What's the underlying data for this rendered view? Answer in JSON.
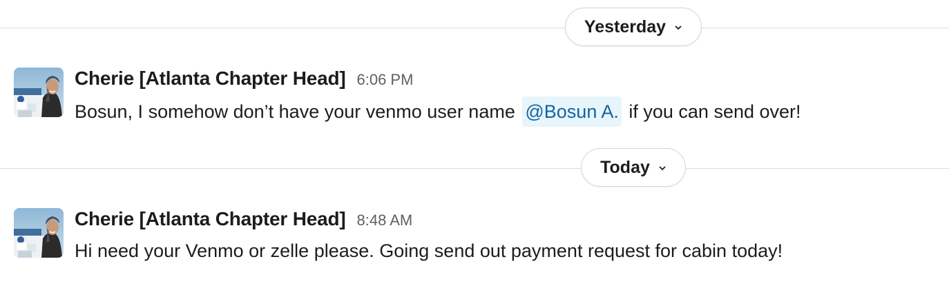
{
  "days": [
    {
      "label": "Yesterday"
    },
    {
      "label": "Today"
    }
  ],
  "messages": [
    {
      "sender": "Cherie [Atlanta Chapter Head]",
      "time": "6:06 PM",
      "text_before": "Bosun, I somehow don’t have your venmo user name",
      "mention": "@Bosun A.",
      "text_after": " if you can send over!"
    },
    {
      "sender": "Cherie [Atlanta Chapter Head]",
      "time": "8:48 AM",
      "text": "Hi need your Venmo or zelle please. Going send out payment request for cabin today!"
    }
  ],
  "colors": {
    "mention_bg": "#e8f5fa",
    "mention_text": "#1264a3",
    "timestamp": "#616061",
    "divider": "#dddddd"
  },
  "icons": {
    "day_divider_toggle": "chevron-down-icon",
    "avatar": "user-avatar-photo"
  }
}
